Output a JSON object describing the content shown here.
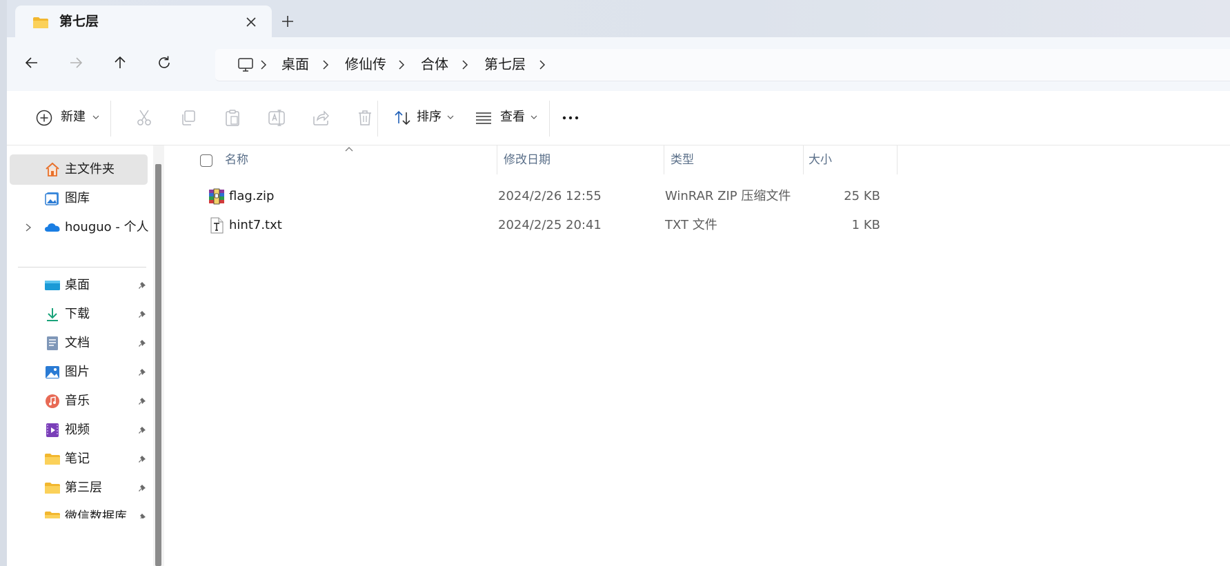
{
  "window": {
    "tab_title": "第七层",
    "new_tab_symbol": "+"
  },
  "nav_buttons": {
    "back": "back-arrow-icon",
    "forward": "forward-arrow-icon",
    "up": "up-arrow-icon",
    "refresh": "refresh-icon"
  },
  "breadcrumb": {
    "items": [
      "桌面",
      "修仙传",
      "合体",
      "第七层"
    ]
  },
  "toolbar": {
    "new_label": "新建",
    "sort_label": "排序",
    "view_label": "查看",
    "more_symbol": "•••"
  },
  "sidebar": {
    "items": [
      {
        "label": "主文件夹",
        "icon": "home-icon",
        "selected": true
      },
      {
        "label": "图库",
        "icon": "gallery-icon"
      },
      {
        "label": "houguo - 个人",
        "icon": "onedrive-cloud-icon"
      },
      {
        "label": "桌面",
        "icon": "desktop-icon",
        "pinned": true
      },
      {
        "label": "下载",
        "icon": "download-icon",
        "pinned": true
      },
      {
        "label": "文档",
        "icon": "documents-icon",
        "pinned": true
      },
      {
        "label": "图片",
        "icon": "pictures-icon",
        "pinned": true
      },
      {
        "label": "音乐",
        "icon": "music-icon",
        "pinned": true
      },
      {
        "label": "视频",
        "icon": "videos-icon",
        "pinned": true
      },
      {
        "label": "笔记",
        "icon": "folder-icon",
        "pinned": true
      },
      {
        "label": "第三层",
        "icon": "folder-icon",
        "pinned": true
      },
      {
        "label": "微信数据库",
        "icon": "folder-icon",
        "pinned": true
      }
    ]
  },
  "file_list": {
    "columns": [
      "名称",
      "修改日期",
      "类型",
      "大小"
    ],
    "rows": [
      {
        "name": "flag.zip",
        "modified": "2024/2/26 12:55",
        "type": "WinRAR ZIP 压缩文件",
        "size": "25 KB",
        "icon": "winrar-archive-icon"
      },
      {
        "name": "hint7.txt",
        "modified": "2024/2/25 20:41",
        "type": "TXT 文件",
        "size": "1 KB",
        "icon": "text-file-icon"
      }
    ]
  },
  "colors": {
    "tabbar_bg": "#dfe5ee",
    "selected_nav_bg": "#e5e5e5",
    "column_header_text": "#5a6f89",
    "accent_blue": "#2a7bd4",
    "folder_yellow": "#f7c948"
  }
}
